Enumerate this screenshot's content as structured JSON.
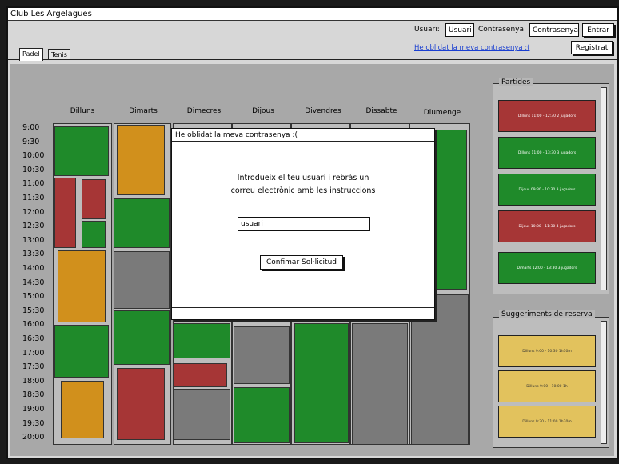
{
  "window": {
    "title": "Club Les Argelagues"
  },
  "header": {
    "user_label": "Usuari:",
    "user_value": "Usuari",
    "pass_label": "Contrasenya:",
    "pass_value": "Contrasenya",
    "login_button": "Entrar",
    "forgot_link": "He oblidat la meva contrasenya :(",
    "register_button": "Registrat"
  },
  "tabs": [
    {
      "label": "Padel",
      "active": true
    },
    {
      "label": "Tenis",
      "active": false
    }
  ],
  "schedule": {
    "days": [
      "Dilluns",
      "Dimarts",
      "Dimecres",
      "Dijous",
      "Divendres",
      "Dissabte",
      "Diumenge"
    ],
    "times": [
      "9:00",
      "9:30",
      "10:00",
      "10:30",
      "11:00",
      "11:30",
      "12:00",
      "12:30",
      "13:00",
      "13:30",
      "14:00",
      "14:30",
      "15:00",
      "15:30",
      "16:00",
      "16:30",
      "17:00",
      "17:30",
      "18:00",
      "18:30",
      "19:00",
      "19:30",
      "20:00"
    ]
  },
  "partides": {
    "title": "Partides",
    "items": [
      {
        "text": "Dilluns 11:00 - 12:30 2 jugadors",
        "color": "#a63636"
      },
      {
        "text": "Dilluns 11:00 - 13:30 3 jugadors",
        "color": "#1f8a2a"
      },
      {
        "text": "Dijous 09:30 - 10:30 3 jugadors",
        "color": "#1f8a2a"
      },
      {
        "text": "Dijous 10:00 - 11:30 4 jugadors",
        "color": "#a63636"
      },
      {
        "text": "Dimarts 12:00 - 13:30 3 jugadors",
        "color": "#1f8a2a"
      }
    ]
  },
  "suggeriments": {
    "title": "Suggeriments de reserva",
    "items": [
      "Dilluns 9:00 - 10:30 1h30m",
      "Dilluns 9:00 - 10:00 1h",
      "Dilluns 9:30 - 11:00 1h30m"
    ]
  },
  "dialog": {
    "title": "He oblidat la meva contrasenya :(",
    "line1": "Introdueix el teu usuari i rebràs un",
    "line2": "correu electrònic amb les instruccions",
    "input_value": "usuari",
    "confirm_button": "Confimar Sol·licitud"
  },
  "colors": {
    "green": "#1f8a2a",
    "red": "#a63636",
    "orange": "#d1901c",
    "gray": "#7a7a7a",
    "suggestion": "#e2c25d"
  }
}
